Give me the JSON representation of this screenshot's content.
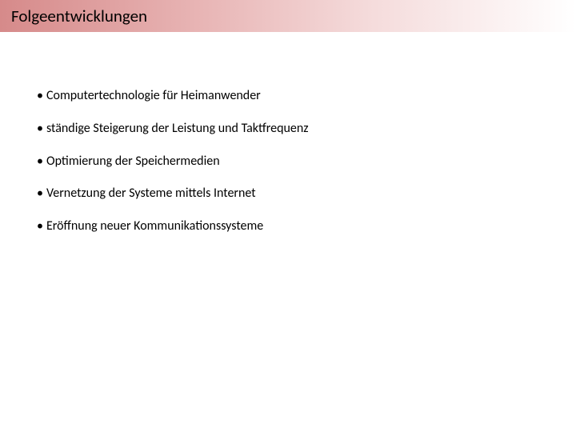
{
  "title": "Folgeentwicklungen",
  "bullets": [
    "Computertechnologie für Heimanwender",
    "ständige Steigerung der Leistung und Taktfrequenz",
    "Optimierung der Speichermedien",
    "Vernetzung der Systeme mittels Internet",
    "Eröffnung neuer Kommunikationssysteme"
  ]
}
